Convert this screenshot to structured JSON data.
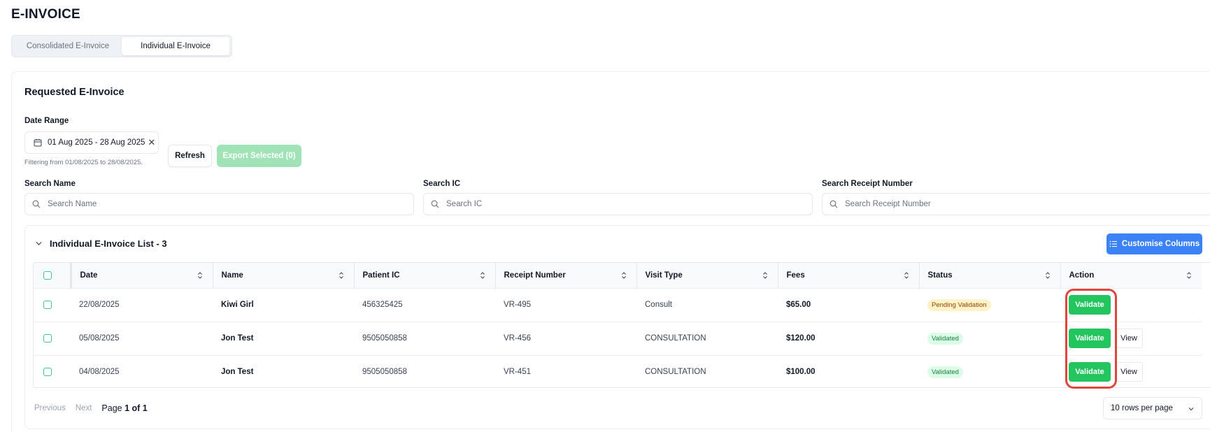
{
  "page": {
    "title": "E-INVOICE"
  },
  "tabs": [
    {
      "label": "Consolidated E-Invoice",
      "active": false
    },
    {
      "label": "Individual E-Invoice",
      "active": true
    }
  ],
  "section": {
    "title": "Requested E-Invoice"
  },
  "date_range": {
    "label": "Date Range",
    "value": "01 Aug 2025 - 28 Aug 2025",
    "clear_glyph": "✕",
    "note": "Filtering from 01/08/2025 to 28/08/2025."
  },
  "buttons": {
    "refresh": "Refresh",
    "export": "Export Selected (0)",
    "customise": "Customise Columns"
  },
  "search": {
    "name": {
      "label": "Search Name",
      "placeholder": "Search Name"
    },
    "ic": {
      "label": "Search IC",
      "placeholder": "Search IC"
    },
    "receipt": {
      "label": "Search Receipt Number",
      "placeholder": "Search Receipt Number"
    }
  },
  "list": {
    "title": "Individual E-Invoice List - 3"
  },
  "table": {
    "headers": [
      "Date",
      "Name",
      "Patient IC",
      "Receipt Number",
      "Visit Type",
      "Fees",
      "Status",
      "Action"
    ],
    "rows": [
      {
        "date": "22/08/2025",
        "name": "Kiwi Girl",
        "ic": "456325425",
        "receipt": "VR-495",
        "visit": "Consult",
        "fees": "$65.00",
        "status": "Pending Validation",
        "actions": [
          "Validate"
        ]
      },
      {
        "date": "05/08/2025",
        "name": "Jon Test",
        "ic": "9505050858",
        "receipt": "VR-456",
        "visit": "CONSULTATION",
        "fees": "$120.00",
        "status": "Validated",
        "actions": [
          "Validate",
          "View"
        ]
      },
      {
        "date": "04/08/2025",
        "name": "Jon Test",
        "ic": "9505050858",
        "receipt": "VR-451",
        "visit": "CONSULTATION",
        "fees": "$100.00",
        "status": "Validated",
        "actions": [
          "Validate",
          "View"
        ]
      }
    ]
  },
  "pagination": {
    "previous": "Previous",
    "next": "Next",
    "page_word": "Page",
    "current": "1 of 1",
    "rows_per_page": "10 rows per page"
  },
  "colors": {
    "primary_green": "#22c55e",
    "accent_blue": "#3b82f6",
    "highlight_red": "#e0473b",
    "pending_bg": "#fef3c7",
    "validated_bg": "#dcfce7"
  },
  "icons": [
    "calendar-icon",
    "close-icon",
    "search-icon",
    "chevron-down-icon",
    "list-icon",
    "sort-icon"
  ]
}
